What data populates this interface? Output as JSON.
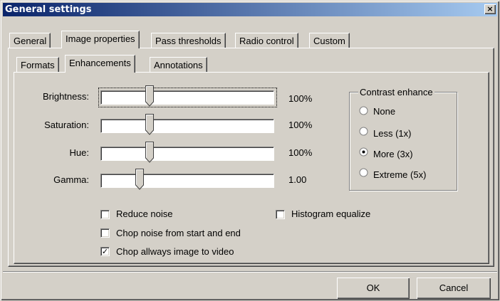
{
  "window": {
    "title": "General settings",
    "close_symbol": "×"
  },
  "tabs": [
    "General",
    "Image properties",
    "Pass thresholds",
    "Radio control",
    "Custom"
  ],
  "active_tab": "Image properties",
  "subtabs": [
    "Formats",
    "Enhancements",
    "Annotations"
  ],
  "active_subtab": "Enhancements",
  "sliders": [
    {
      "label": "Brightness:",
      "value_text": "100%",
      "level": 0.27,
      "focused": true
    },
    {
      "label": "Saturation:",
      "value_text": "100%",
      "level": 0.27,
      "focused": false
    },
    {
      "label": "Hue:",
      "value_text": "100%",
      "level": 0.27,
      "focused": false
    },
    {
      "label": "Gamma:",
      "value_text": "1.00",
      "level": 0.21,
      "focused": false
    }
  ],
  "contrast": {
    "title": "Contrast enhance",
    "options": [
      "None",
      "Less (1x)",
      "More (3x)",
      "Extreme (5x)"
    ],
    "selected": "More (3x)"
  },
  "checkboxes": [
    {
      "label": "Reduce noise",
      "checked": false
    },
    {
      "label": "Histogram equalize",
      "checked": false
    },
    {
      "label": "Chop noise from start and end",
      "checked": false
    },
    {
      "label": "Chop allways image to video",
      "checked": true
    }
  ],
  "buttons": {
    "ok": "OK",
    "cancel": "Cancel"
  }
}
